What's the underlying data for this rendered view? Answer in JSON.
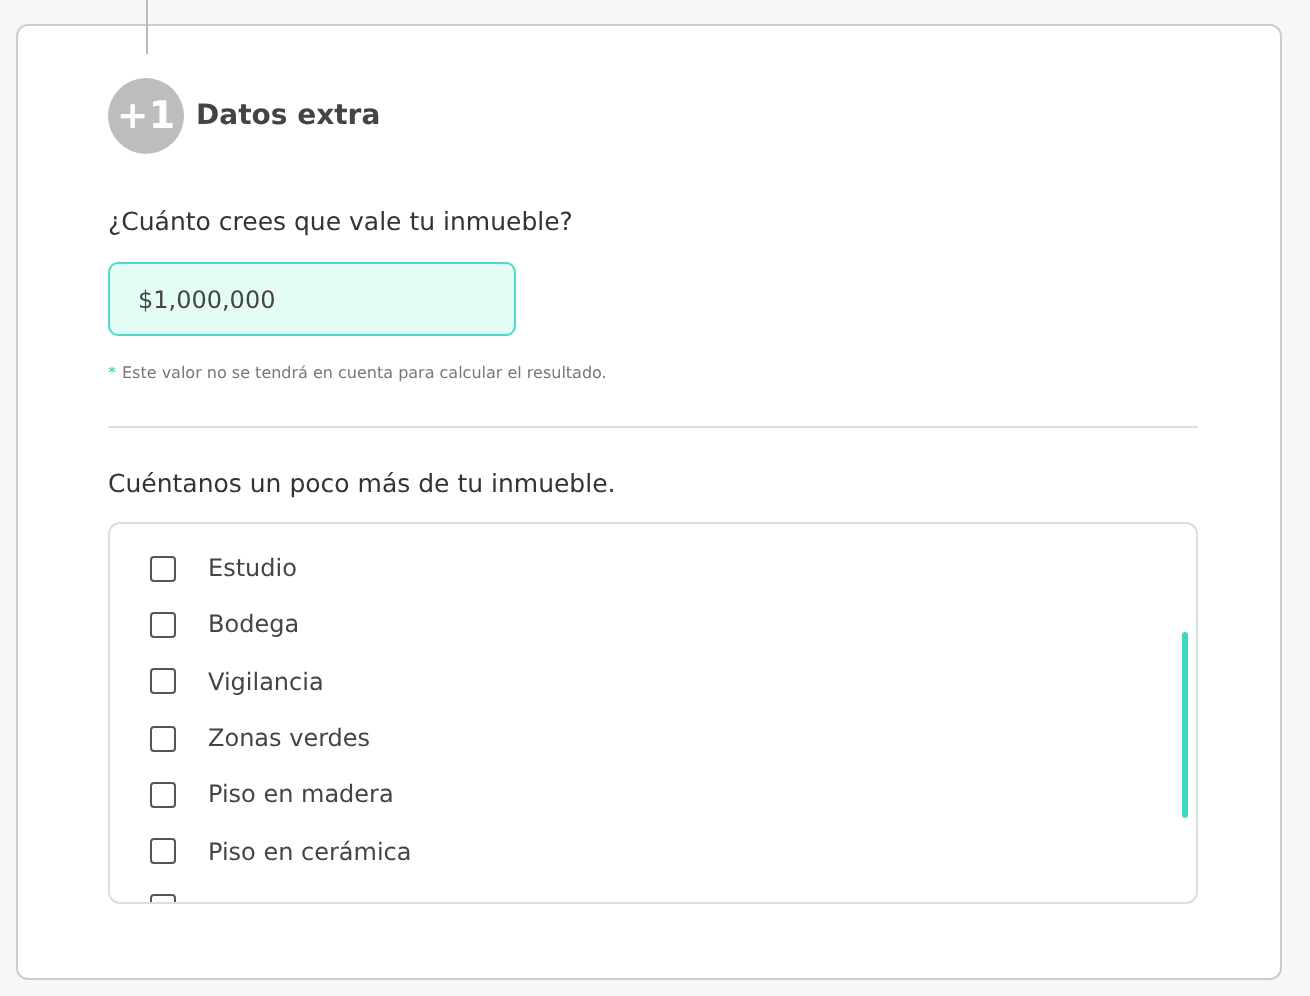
{
  "section": {
    "badge": "+1",
    "title": "Datos extra"
  },
  "value_question": {
    "label": "¿Cuánto crees que vale tu inmueble?",
    "value": "$1,000,000",
    "focused": true,
    "note_mark": "*",
    "note": "Este valor no se tendrá en cuenta para calcular el resultado."
  },
  "features": {
    "label": "Cuéntanos un poco más de tu inmueble.",
    "items": [
      {
        "label": "Estudio",
        "checked": false
      },
      {
        "label": "Bodega",
        "checked": false
      },
      {
        "label": "Vigilancia",
        "checked": false
      },
      {
        "label": "Zonas verdes",
        "checked": false
      },
      {
        "label": "Piso en madera",
        "checked": false
      },
      {
        "label": "Piso en cerámica",
        "checked": false
      },
      {
        "checked": false
      }
    ]
  }
}
